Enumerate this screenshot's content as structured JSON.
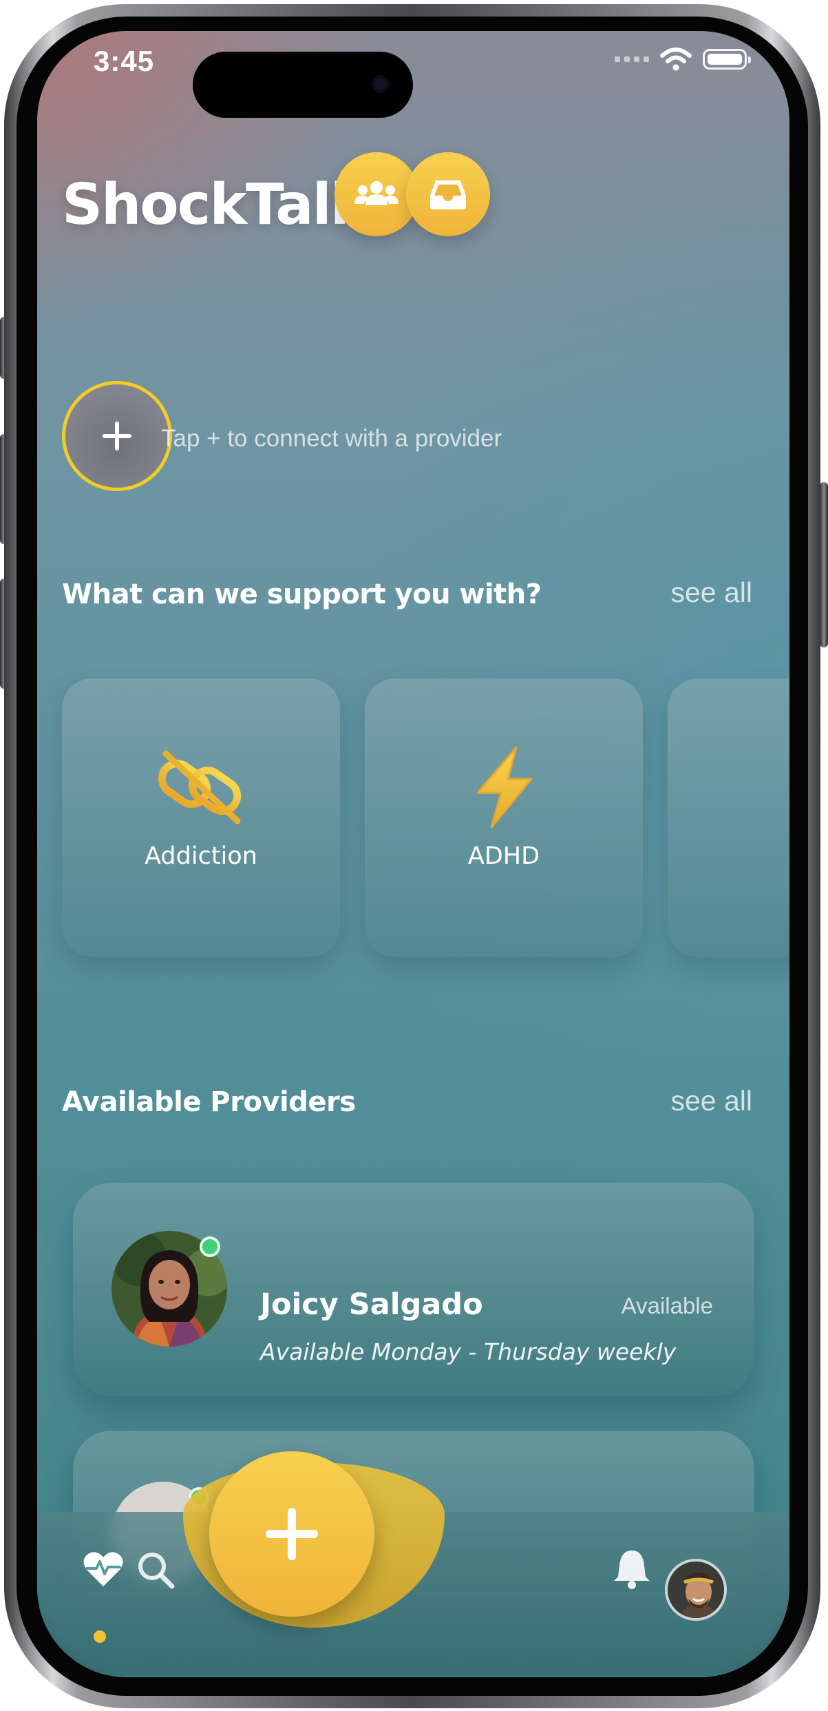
{
  "status_bar": {
    "time": "3:45"
  },
  "header": {
    "app_title": "ShockTalk"
  },
  "connect": {
    "hint": "Tap + to connect with a provider"
  },
  "support_section": {
    "title": "What can we support you with?",
    "see_all": "see all",
    "categories": [
      {
        "label": "Addiction",
        "icon": "unlink-icon"
      },
      {
        "label": "ADHD",
        "icon": "lightning-icon"
      }
    ]
  },
  "providers_section": {
    "title": "Available Providers",
    "see_all": "see all",
    "providers": [
      {
        "name": "Joicy Salgado",
        "status": "Available",
        "schedule": "Available Monday - Thursday weekly",
        "online": true
      }
    ]
  },
  "tabbar": {
    "items": [
      "heart-pulse-icon",
      "search-icon",
      "plus-icon",
      "bell-icon",
      "profile-avatar"
    ],
    "active_index": 0
  },
  "colors": {
    "accent": "#F2C233",
    "online": "#3FD17A"
  }
}
